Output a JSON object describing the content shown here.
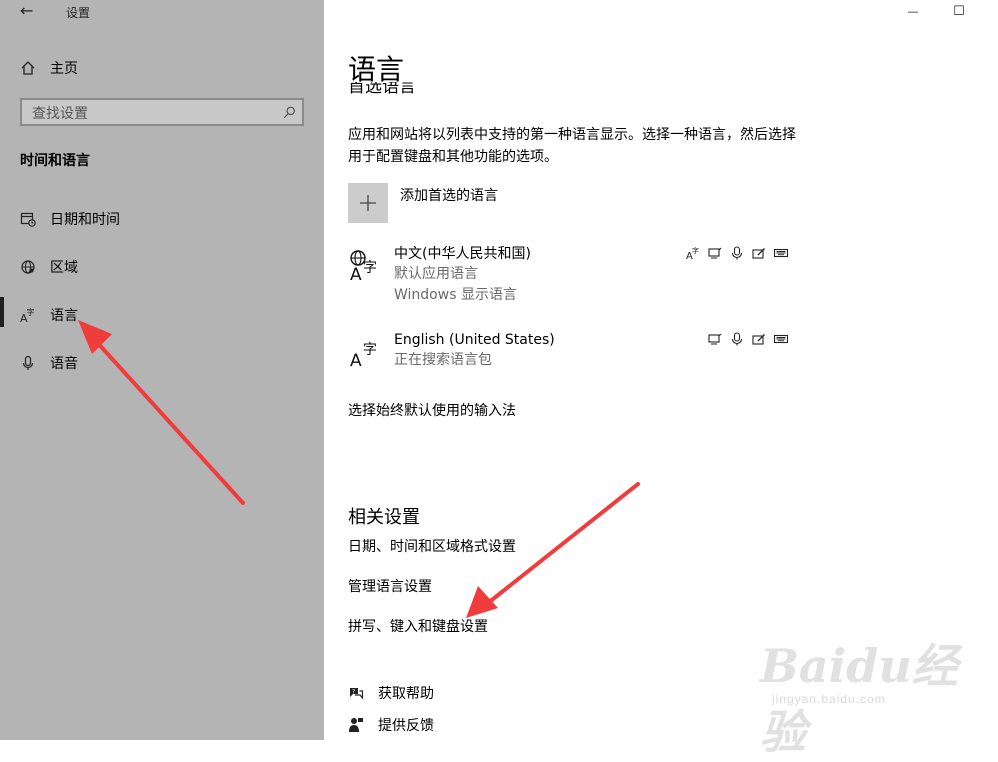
{
  "window": {
    "title": "设置",
    "minimize_glyph": "—",
    "maximize_glyph": "☐"
  },
  "sidebar": {
    "home_label": "主页",
    "search_placeholder": "查找设置",
    "section_title": "时间和语言",
    "items": [
      {
        "label": "日期和时间",
        "icon": "clock-calendar-icon",
        "active": false
      },
      {
        "label": "区域",
        "icon": "globe-icon",
        "active": false
      },
      {
        "label": "语言",
        "icon": "language-icon",
        "active": true
      },
      {
        "label": "语音",
        "icon": "microphone-icon",
        "active": false
      }
    ]
  },
  "main": {
    "page_title": "语言",
    "preferred_heading": "首选语言",
    "description": "应用和网站将以列表中支持的第一种语言显示。选择一种语言，然后选择用于配置键盘和其他功能的选项。",
    "add_language_label": "添加首选的语言",
    "languages": [
      {
        "name": "中文(中华人民共和国)",
        "sub1": "默认应用语言",
        "sub2": "Windows 显示语言"
      },
      {
        "name": "English (United States)",
        "sub1": "正在搜索语言包"
      }
    ],
    "default_input_link": "选择始终默认使用的输入法",
    "related_title": "相关设置",
    "related_links": [
      "日期、时间和区域格式设置",
      "管理语言设置",
      "拼写、键入和键盘设置"
    ],
    "help_label": "获取帮助",
    "feedback_label": "提供反馈"
  },
  "watermark": {
    "brand": "Baidu经验",
    "url": "jingyan.baidu.com"
  },
  "colors": {
    "sidebar_bg": "#b4b4b4",
    "annotation_arrow": "#f03c3c"
  }
}
